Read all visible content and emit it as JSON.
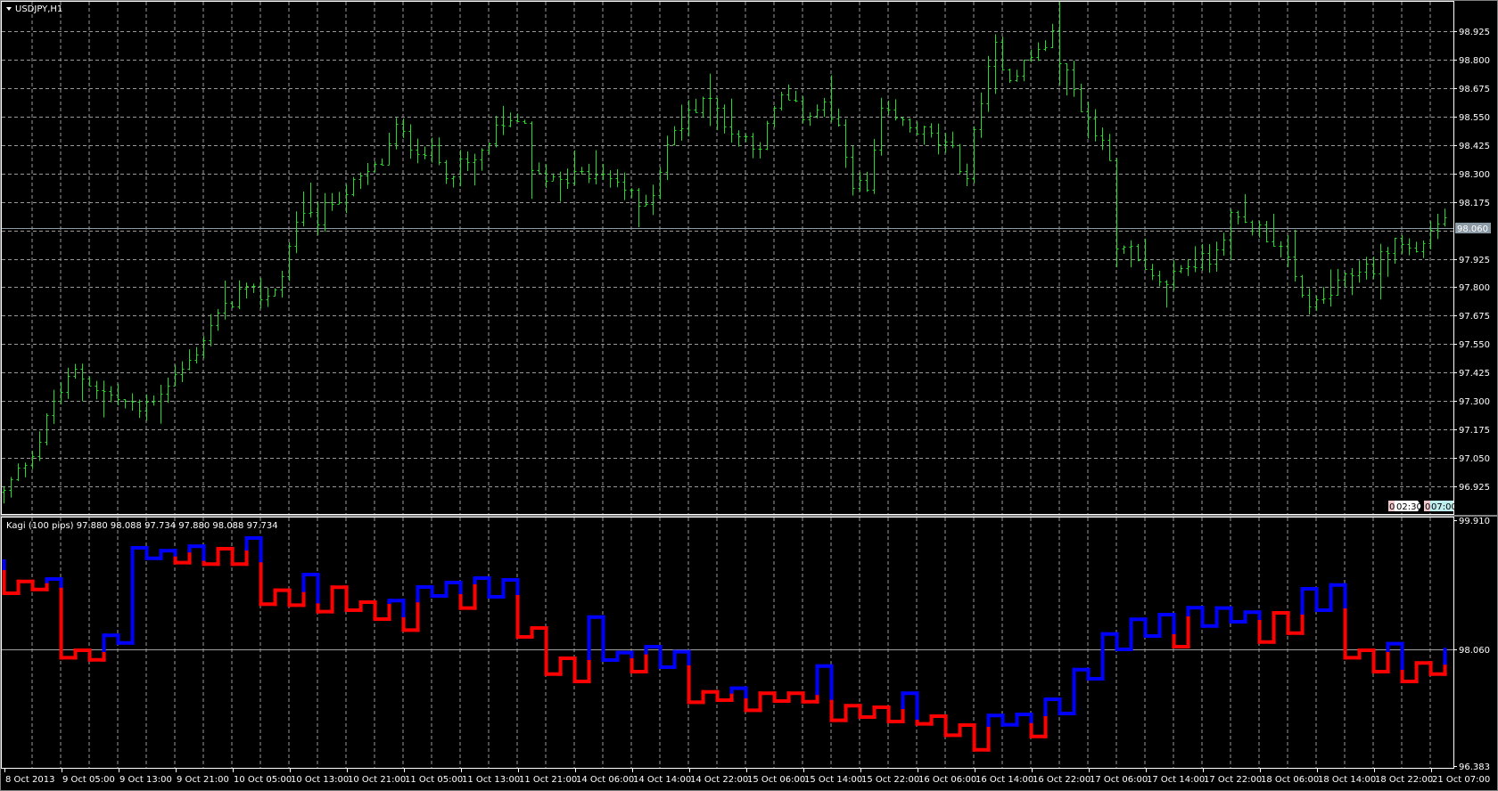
{
  "window": {
    "title": "USDJPY,H1",
    "title_icon": "triangle-down-icon"
  },
  "colors": {
    "bars": "#22dd22",
    "yang": "#0000ff",
    "yin": "#ff0000",
    "grid": "#9a9a9a",
    "current_price_bg": "#8c9aa6"
  },
  "indicator": {
    "label": "Kagi (100 pips) 97.880 98.088 97.734 97.880 98.088 97.734"
  },
  "timers": [
    {
      "count": "0",
      "time": "02:30"
    },
    {
      "count": "0",
      "time": "07:00"
    }
  ],
  "chart_data": [
    {
      "type": "ohlc",
      "title": "USDJPY,H1",
      "ylim": [
        96.925,
        98.925
      ],
      "y_ticks": [
        "98.925",
        "98.800",
        "98.675",
        "98.550",
        "98.425",
        "98.300",
        "98.175",
        "97.925",
        "97.800",
        "97.675",
        "97.550",
        "97.425",
        "97.300",
        "97.175",
        "97.050",
        "96.925"
      ],
      "current_price": "98.060",
      "grid": true,
      "price_path_bar_index": [
        0,
        5,
        7,
        10,
        14,
        19,
        23,
        26,
        29,
        33,
        37,
        39,
        41,
        44,
        46,
        50,
        53,
        55,
        57,
        60,
        62,
        66,
        69,
        73,
        74,
        77,
        82,
        86,
        89,
        91,
        93,
        96,
        98,
        100,
        102,
        106,
        109,
        112,
        115,
        117,
        119,
        121,
        123,
        126,
        129,
        133,
        135,
        137,
        139,
        141,
        144,
        147,
        149,
        151,
        153,
        155,
        156,
        157,
        160,
        162,
        165,
        169,
        172,
        176,
        179,
        182,
        184,
        187,
        190,
        192,
        195,
        198,
        200,
        202
      ],
      "price_path_close": [
        96.9,
        97.13,
        97.3,
        97.43,
        97.34,
        97.26,
        97.38,
        97.47,
        97.63,
        97.78,
        97.76,
        97.85,
        98.1,
        98.1,
        98.18,
        98.27,
        98.35,
        98.5,
        98.43,
        98.39,
        98.31,
        98.35,
        98.48,
        98.54,
        98.29,
        98.29,
        98.29,
        98.27,
        98.16,
        98.22,
        98.43,
        98.56,
        98.64,
        98.58,
        98.48,
        98.43,
        98.64,
        98.56,
        98.6,
        98.48,
        98.27,
        98.22,
        98.56,
        98.52,
        98.48,
        98.39,
        98.29,
        98.64,
        98.85,
        98.73,
        98.81,
        98.9,
        98.73,
        98.6,
        98.48,
        98.39,
        97.97,
        98.01,
        97.85,
        97.8,
        97.89,
        97.93,
        98.1,
        98.06,
        97.97,
        97.76,
        97.72,
        97.8,
        97.89,
        97.89,
        98.01,
        97.95,
        98.06,
        98.1
      ]
    },
    {
      "type": "kagi",
      "title": "Kagi (100 pips)",
      "ylim": [
        96.383,
        99.91
      ],
      "y_ticks": [
        "99.910",
        "98.060",
        "96.383"
      ],
      "reference_line": 98.06,
      "initial_state": "yang",
      "initial_waist": 99.17,
      "levels": [
        99.322,
        98.862,
        99.032,
        98.917,
        99.067,
        97.938,
        98.044,
        97.907,
        98.258,
        98.15,
        99.514,
        99.364,
        99.472,
        99.301,
        99.536,
        99.28,
        99.501,
        99.28,
        99.654,
        98.705,
        98.905,
        98.692,
        99.13,
        98.598,
        98.948,
        98.619,
        98.734,
        98.491,
        98.756,
        98.334,
        98.952,
        98.824,
        99.016,
        98.649,
        99.079,
        98.811,
        99.054,
        98.236,
        98.364,
        97.703,
        97.929,
        97.597,
        98.521,
        97.904,
        98.01,
        97.738,
        98.095,
        97.802,
        98.023,
        97.299,
        97.447,
        97.329,
        97.499,
        97.184,
        97.427,
        97.316,
        97.427,
        97.307,
        97.818,
        97.039,
        97.248,
        97.086,
        97.226,
        97.022,
        97.427,
        96.988,
        97.099,
        96.826,
        96.971,
        96.617,
        97.108,
        96.975,
        97.124,
        96.808,
        97.341,
        97.137,
        97.767,
        97.635,
        98.278,
        98.057,
        98.488,
        98.249,
        98.555,
        98.095,
        98.654,
        98.393,
        98.649,
        98.453,
        98.59,
        98.163,
        98.581,
        98.291,
        98.926,
        98.619,
        98.981,
        97.938,
        98.044,
        97.738,
        98.138,
        97.597,
        97.862,
        97.703,
        98.053
      ]
    }
  ],
  "time_axis": [
    "8 Oct 2013",
    "9 Oct 05:00",
    "9 Oct 13:00",
    "9 Oct 21:00",
    "10 Oct 05:00",
    "10 Oct 13:00",
    "10 Oct 21:00",
    "11 Oct 05:00",
    "11 Oct 13:00",
    "11 Oct 21:00",
    "14 Oct 06:00",
    "14 Oct 14:00",
    "14 Oct 22:00",
    "15 Oct 06:00",
    "15 Oct 14:00",
    "15 Oct 22:00",
    "16 Oct 06:00",
    "16 Oct 14:00",
    "16 Oct 22:00",
    "17 Oct 06:00",
    "17 Oct 14:00",
    "17 Oct 22:00",
    "18 Oct 06:00",
    "18 Oct 14:00",
    "18 Oct 22:00",
    "21 Oct 07:00"
  ]
}
